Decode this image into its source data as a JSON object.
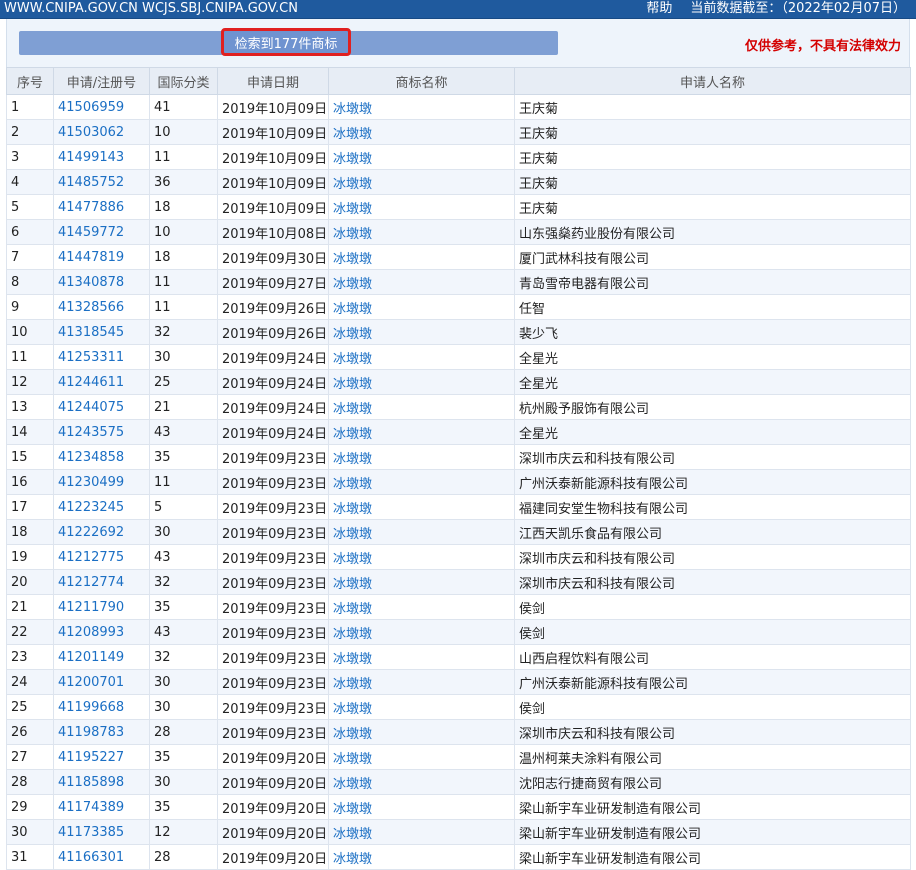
{
  "topbar": {
    "url": "WWW.CNIPA.GOV.CN  WCJS.SBJ.CNIPA.GOV.CN",
    "help": "帮助",
    "date_label": "当前数据截至：（2022年02月07日）"
  },
  "search": {
    "result_label": "检索到177件商标",
    "disclaimer": "仅供参考，不具有法律效力"
  },
  "table": {
    "headers": [
      "序号",
      "申请/注册号",
      "国际分类",
      "申请日期",
      "商标名称",
      "申请人名称"
    ],
    "rows": [
      [
        "1",
        "41506959",
        "41",
        "2019年10月09日",
        "冰墩墩",
        "王庆菊"
      ],
      [
        "2",
        "41503062",
        "10",
        "2019年10月09日",
        "冰墩墩",
        "王庆菊"
      ],
      [
        "3",
        "41499143",
        "11",
        "2019年10月09日",
        "冰墩墩",
        "王庆菊"
      ],
      [
        "4",
        "41485752",
        "36",
        "2019年10月09日",
        "冰墩墩",
        "王庆菊"
      ],
      [
        "5",
        "41477886",
        "18",
        "2019年10月09日",
        "冰墩墩",
        "王庆菊"
      ],
      [
        "6",
        "41459772",
        "10",
        "2019年10月08日",
        "冰墩墩",
        "山东强燊药业股份有限公司"
      ],
      [
        "7",
        "41447819",
        "18",
        "2019年09月30日",
        "冰墩墩",
        "厦门武林科技有限公司"
      ],
      [
        "8",
        "41340878",
        "11",
        "2019年09月27日",
        "冰墩墩",
        "青岛雪帝电器有限公司"
      ],
      [
        "9",
        "41328566",
        "11",
        "2019年09月26日",
        "冰墩墩",
        "任智"
      ],
      [
        "10",
        "41318545",
        "32",
        "2019年09月26日",
        "冰墩墩",
        "裴少飞"
      ],
      [
        "11",
        "41253311",
        "30",
        "2019年09月24日",
        "冰墩墩",
        "全星光"
      ],
      [
        "12",
        "41244611",
        "25",
        "2019年09月24日",
        "冰墩墩",
        "全星光"
      ],
      [
        "13",
        "41244075",
        "21",
        "2019年09月24日",
        "冰墩墩",
        "杭州殿予服饰有限公司"
      ],
      [
        "14",
        "41243575",
        "43",
        "2019年09月24日",
        "冰墩墩",
        "全星光"
      ],
      [
        "15",
        "41234858",
        "35",
        "2019年09月23日",
        "冰墩墩",
        "深圳市庆云和科技有限公司"
      ],
      [
        "16",
        "41230499",
        "11",
        "2019年09月23日",
        "冰墩墩",
        "广州沃泰新能源科技有限公司"
      ],
      [
        "17",
        "41223245",
        "5",
        "2019年09月23日",
        "冰墩墩",
        "福建同安堂生物科技有限公司"
      ],
      [
        "18",
        "41222692",
        "30",
        "2019年09月23日",
        "冰墩墩",
        "江西天凯乐食品有限公司"
      ],
      [
        "19",
        "41212775",
        "43",
        "2019年09月23日",
        "冰墩墩",
        "深圳市庆云和科技有限公司"
      ],
      [
        "20",
        "41212774",
        "32",
        "2019年09月23日",
        "冰墩墩",
        "深圳市庆云和科技有限公司"
      ],
      [
        "21",
        "41211790",
        "35",
        "2019年09月23日",
        "冰墩墩",
        "侯剑"
      ],
      [
        "22",
        "41208993",
        "43",
        "2019年09月23日",
        "冰墩墩",
        "侯剑"
      ],
      [
        "23",
        "41201149",
        "32",
        "2019年09月23日",
        "冰墩墩",
        "山西启程饮料有限公司"
      ],
      [
        "24",
        "41200701",
        "30",
        "2019年09月23日",
        "冰墩墩",
        "广州沃泰新能源科技有限公司"
      ],
      [
        "25",
        "41199668",
        "30",
        "2019年09月23日",
        "冰墩墩",
        "侯剑"
      ],
      [
        "26",
        "41198783",
        "28",
        "2019年09月23日",
        "冰墩墩",
        "深圳市庆云和科技有限公司"
      ],
      [
        "27",
        "41195227",
        "35",
        "2019年09月20日",
        "冰墩墩",
        "温州柯莱夫涂料有限公司"
      ],
      [
        "28",
        "41185898",
        "30",
        "2019年09月20日",
        "冰墩墩",
        "沈阳志行捷商贸有限公司"
      ],
      [
        "29",
        "41174389",
        "35",
        "2019年09月20日",
        "冰墩墩",
        "梁山新宇车业研发制造有限公司"
      ],
      [
        "30",
        "41173385",
        "12",
        "2019年09月20日",
        "冰墩墩",
        "梁山新宇车业研发制造有限公司"
      ],
      [
        "31",
        "41166301",
        "28",
        "2019年09月20日",
        "冰墩墩",
        "梁山新宇车业研发制造有限公司"
      ]
    ]
  },
  "colors": {
    "topbar": "#1f5a9e",
    "link": "#1b6fc4",
    "disclaimer": "#d40000",
    "highlight_border": "#e02020"
  }
}
